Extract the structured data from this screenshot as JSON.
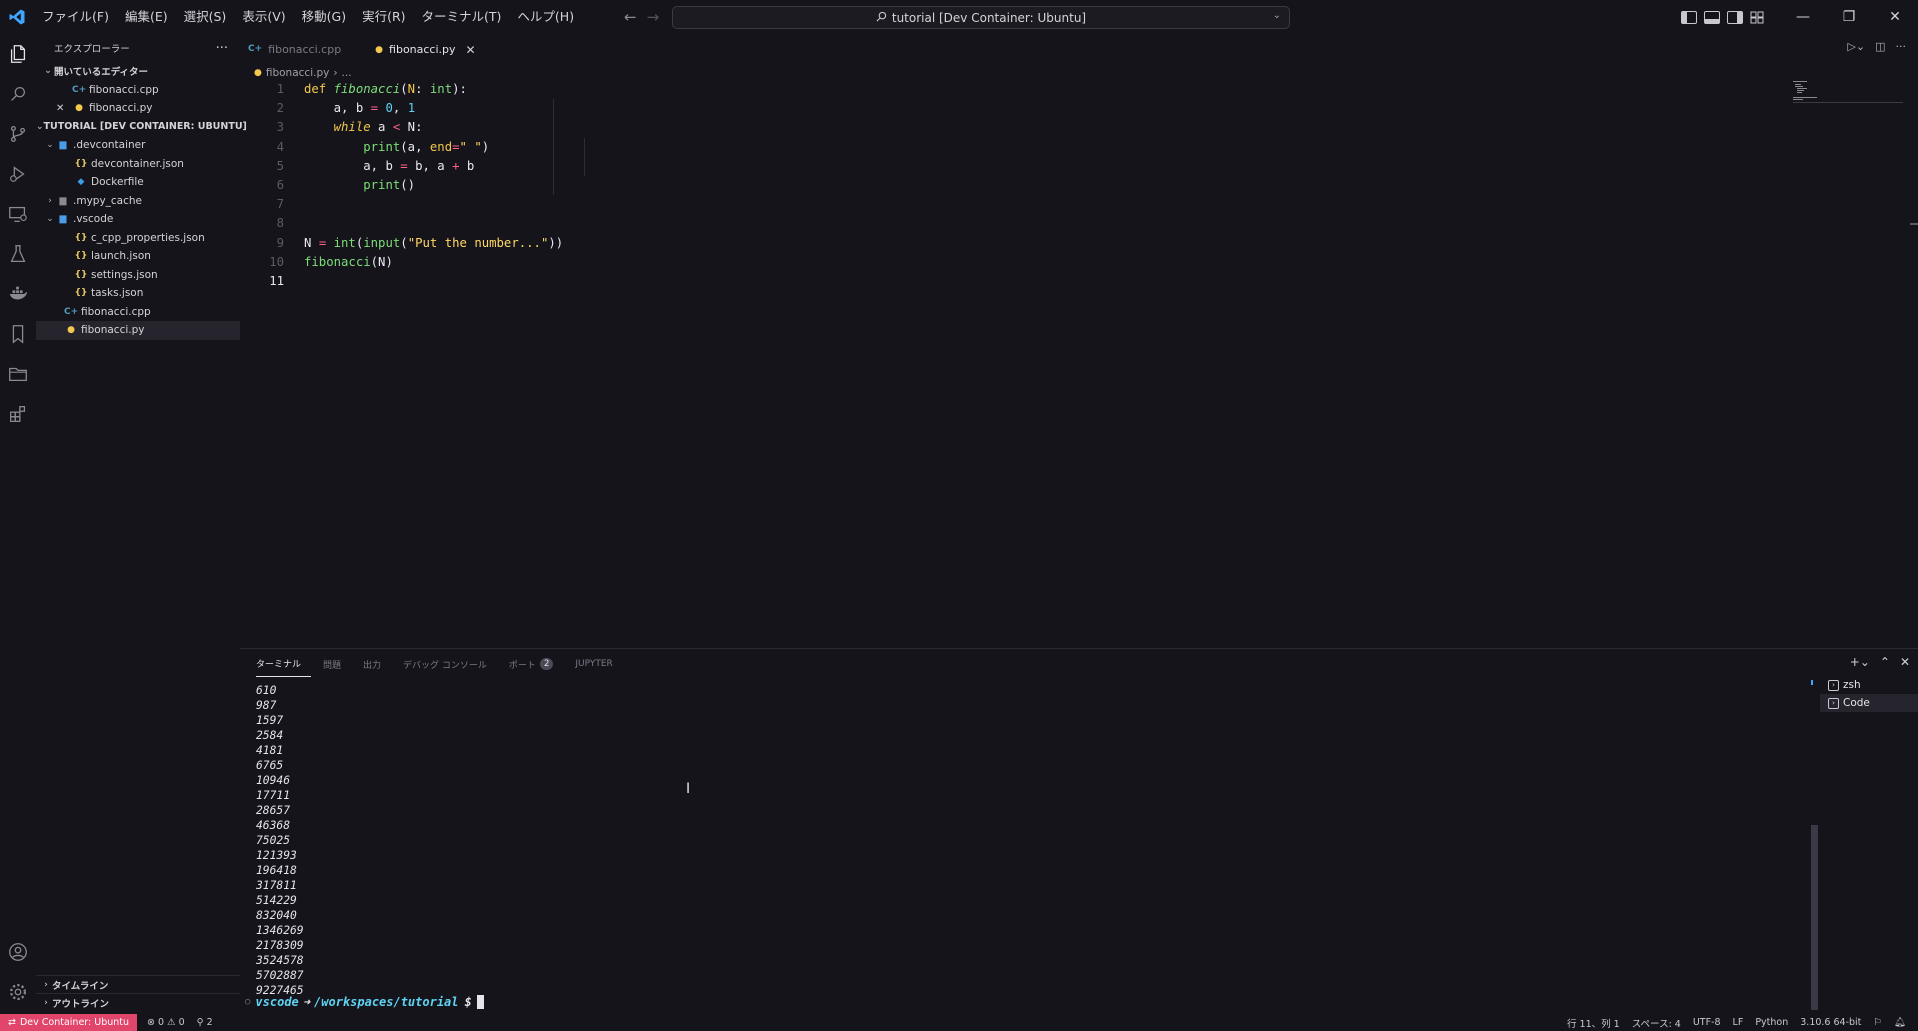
{
  "window": {
    "title": "tutorial [Dev Container: Ubuntu]"
  },
  "menu": [
    "ファイル(F)",
    "編集(E)",
    "選択(S)",
    "表示(V)",
    "移動(G)",
    "実行(R)",
    "ターミナル(T)",
    "ヘルプ(H)"
  ],
  "sidebar": {
    "title": "エクスプローラー",
    "open_editors": {
      "label": "開いているエディター",
      "items": [
        "fibonacci.cpp",
        "fibonacci.py"
      ]
    },
    "workspace": {
      "label": "TUTORIAL [DEV CONTAINER: UBUNTU]",
      "items": [
        ".devcontainer",
        "devcontainer.json",
        "Dockerfile",
        ".mypy_cache",
        ".vscode",
        "c_cpp_properties.json",
        "launch.json",
        "settings.json",
        "tasks.json",
        "fibonacci.cpp",
        "fibonacci.py"
      ]
    },
    "timeline": "タイムライン",
    "outline": "アウトライン"
  },
  "editor": {
    "tabs": [
      "fibonacci.cpp",
      "fibonacci.py"
    ],
    "active_tab": "fibonacci.py",
    "breadcrumb": [
      "fibonacci.py",
      "..."
    ],
    "current_line": 11,
    "code": {
      "l1": {
        "def": "def",
        "name": "fibonacci",
        "p1": "(",
        "param": "N",
        "colon": ": ",
        "type": "int",
        "p2": "):"
      },
      "l2": {
        "a": "a, b ",
        "eq": "=",
        "n0": "0",
        "comma": ", ",
        "n1": "1"
      },
      "l3": {
        "while": "while",
        "a": " a ",
        "lt": "<",
        "n": " N:"
      },
      "l4": {
        "print": "print",
        "p1": "(a, ",
        "end": "end",
        "eq": "=",
        "str": "\" \"",
        "p2": ")"
      },
      "l5": {
        "a": "a, b ",
        "eq": "=",
        "b": " b, a ",
        "plus": "+",
        "b2": " b"
      },
      "l6": {
        "print": "print",
        "p": "()"
      },
      "l9": {
        "n": "N ",
        "eq": "=",
        "int": "int",
        "p1": "(",
        "input": "input",
        "p2": "(",
        "str": "\"Put the number...\"",
        "p3": "))"
      },
      "l10": {
        "fn": "fibonacci",
        "args": "(N)"
      }
    }
  },
  "panel": {
    "tabs": [
      "ターミナル",
      "問題",
      "出力",
      "デバッグ コンソール",
      "ポート",
      "JUPYTER"
    ],
    "ports_badge": "2",
    "terminal_output": [
      "610",
      "987",
      "1597",
      "2584",
      "4181",
      "6765",
      "10946",
      "17711",
      "28657",
      "46368",
      "75025",
      "121393",
      "196418",
      "317811",
      "514229",
      "832040",
      "1346269",
      "2178309",
      "3524578",
      "5702887",
      "9227465"
    ],
    "prompt": {
      "user": "vscode",
      "arrow": "➜",
      "path": "/workspaces/tutorial",
      "symbol": "$"
    },
    "terminals": [
      "zsh",
      "Code"
    ]
  },
  "status": {
    "remote": "Dev Container: Ubuntu",
    "errors": "0",
    "warnings": "0",
    "ports": "2",
    "position": "行 11、列 1",
    "spaces": "スペース: 4",
    "encoding": "UTF-8",
    "eol": "LF",
    "language": "Python",
    "interpreter": "3.10.6 64-bit"
  },
  "colors": {
    "background": "#15141b",
    "keyword": "#f2c94c",
    "function": "#7ddc78",
    "number": "#5fd3f3",
    "operator": "#ff6188",
    "remote_badge": "#e2456b",
    "prompt_user": "#5fd3f3",
    "prompt_path": "#5fd3f3"
  }
}
